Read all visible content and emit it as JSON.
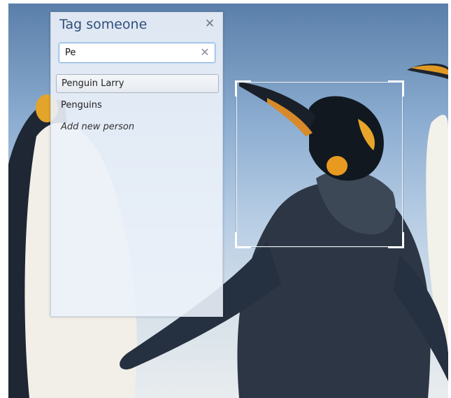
{
  "tag_panel": {
    "title": "Tag someone",
    "close_icon": "close-icon",
    "search": {
      "value": "Pe",
      "placeholder": "",
      "clear_icon": "clear-icon"
    },
    "suggestions": [
      {
        "label": "Penguin Larry",
        "selected": true
      },
      {
        "label": "Penguins",
        "selected": false
      },
      {
        "label": "Add new person",
        "selected": false
      }
    ]
  },
  "photo": {
    "subject": "emperor-penguins-photo"
  }
}
